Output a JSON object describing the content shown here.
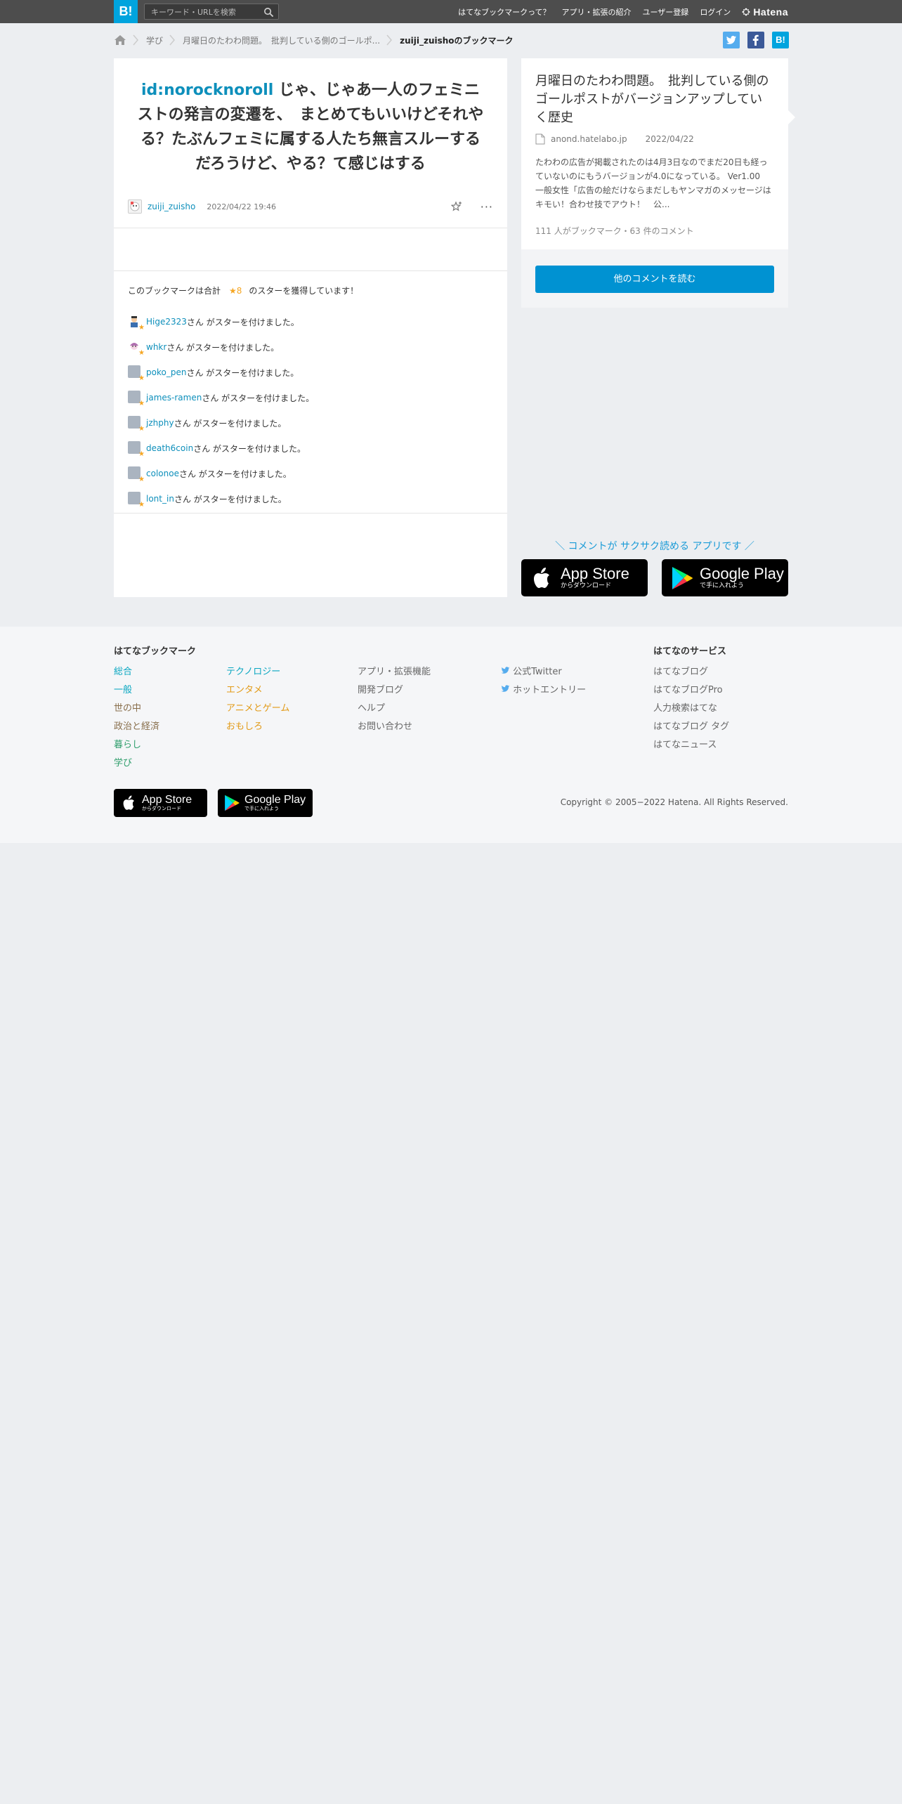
{
  "header": {
    "logo": "B!",
    "search_placeholder": "キーワード・URLを検索",
    "nav": [
      "はてなブックマークって？",
      "アプリ・拡張の紹介",
      "ユーザー登録",
      "ログイン"
    ],
    "brand": "Hatena"
  },
  "breadcrumb": {
    "items": [
      "学び",
      "月曜日のたわわ問題。　批判している側のゴールポ..."
    ],
    "current": "zuiji_zuishoのブックマーク"
  },
  "social": {
    "twitter": "t",
    "facebook": "f",
    "hatena": "B!"
  },
  "bookmark": {
    "uid": "id:norocknoroll",
    "comment": " じゃ、じゃあ一人のフェミニストの発言の変遷を、　まとめてもいいけどそれやる？たぶんフェミに属する人たち無言スルーするだろうけど、やる？て感じはする",
    "user": "zuiji_zuisho",
    "date": "2022/04/22 19:46",
    "more": "···"
  },
  "stars": {
    "summary_pre": "このブックマークは合計",
    "count": "★8",
    "summary_post": "のスターを獲得しています！",
    "suffix": "さん がスターを付けました。",
    "users": [
      "Hige2323",
      "whkr",
      "poko_pen",
      "james-ramen",
      "jzhphy",
      "death6coin",
      "colonoe",
      "lont_in"
    ]
  },
  "entry": {
    "title": "月曜日のたわわ問題。　批判している側のゴールポストがバージョンアップしていく歴史",
    "domain": "anond.hatelabo.jp",
    "date": "2022/04/22",
    "description": "たわわの広告が掲載されたのは4月3日なのでまだ20日も経っていないのにもうバージョンが4.0になっている。 Ver1.00　一般女性「広告の絵だけならまだしもヤンマガのメッセージはキモい！合わせ技でアウト！　公...",
    "counts": "111 人がブックマーク・63 件のコメント",
    "read_button": "他のコメントを読む"
  },
  "promo": {
    "text": "＼ コメントが サクサク読める アプリです ／",
    "appstore_big": "App Store",
    "appstore_small": "からダウンロード",
    "googleplay_big": "Google Play",
    "googleplay_small": "で手に入れよう"
  },
  "footer": {
    "bookmark_heading": "はてなブックマーク",
    "col1": [
      "総合",
      "一般",
      "世の中",
      "政治と経済",
      "暮らし",
      "学び"
    ],
    "col2": [
      "テクノロジー",
      "エンタメ",
      "アニメとゲーム",
      "おもしろ"
    ],
    "col3": [
      "アプリ・拡張機能",
      "開発ブログ",
      "ヘルプ",
      "お問い合わせ"
    ],
    "col4": [
      "公式Twitter",
      "ホットエントリー"
    ],
    "services_heading": "はてなのサービス",
    "services": [
      "はてなブログ",
      "はてなブログPro",
      "人力検索はてな",
      "はてなブログ タグ",
      "はてなニュース"
    ],
    "copyright": "Copyright © 2005−2022 Hatena. All Rights Reserved."
  },
  "colors": {
    "accent": "#00a4de",
    "link": "#0d8fbb",
    "star": "#f5a623",
    "button": "#0092d2"
  }
}
